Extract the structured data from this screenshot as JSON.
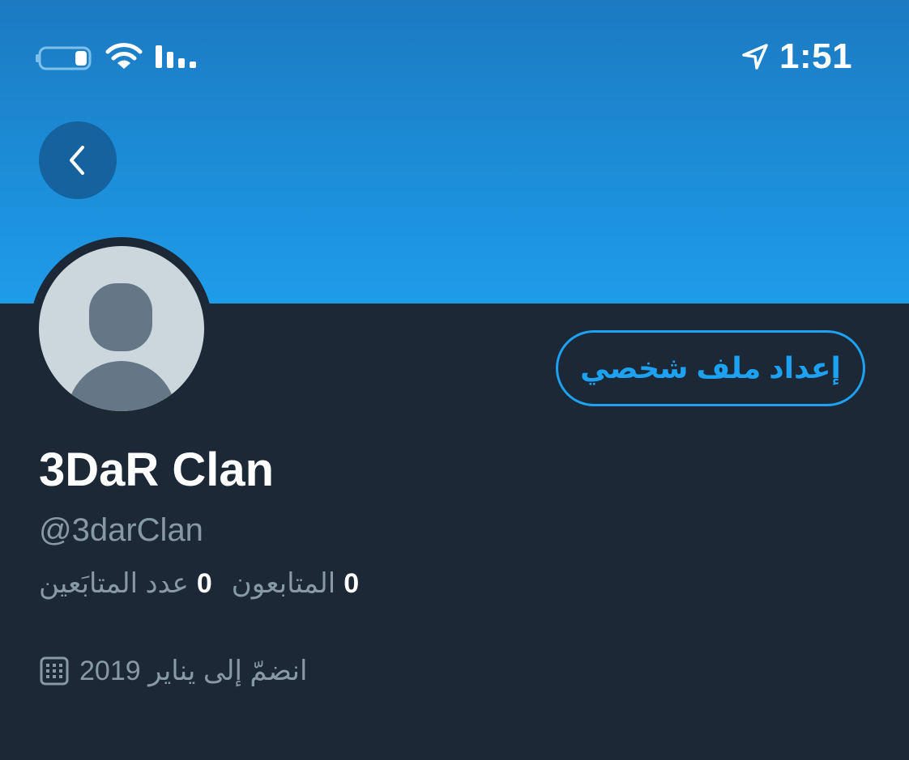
{
  "status_bar": {
    "time": "1:51"
  },
  "header": {
    "color_top": "#1b7ac2",
    "color_bottom": "#1e9ce9"
  },
  "profile": {
    "display_name": "3DaR Clan",
    "handle": "@3darClan",
    "edit_button_label": "إعداد ملف شخصي",
    "followers_count": "0",
    "followers_label": "المتابعون",
    "following_count": "0",
    "following_label": "عدد المتابَعين",
    "joined_text": "انضمّ إلى يناير 2019"
  },
  "colors": {
    "background": "#1c2836",
    "accent": "#1da1f2",
    "secondary_text": "#8899a6",
    "primary_text": "#ffffff"
  },
  "icons": {
    "back": "chevron-left-icon",
    "battery": "battery-icon",
    "wifi": "wifi-icon",
    "signal": "signal-icon",
    "location": "location-arrow-icon",
    "calendar": "calendar-icon",
    "avatar": "default-avatar-icon"
  }
}
